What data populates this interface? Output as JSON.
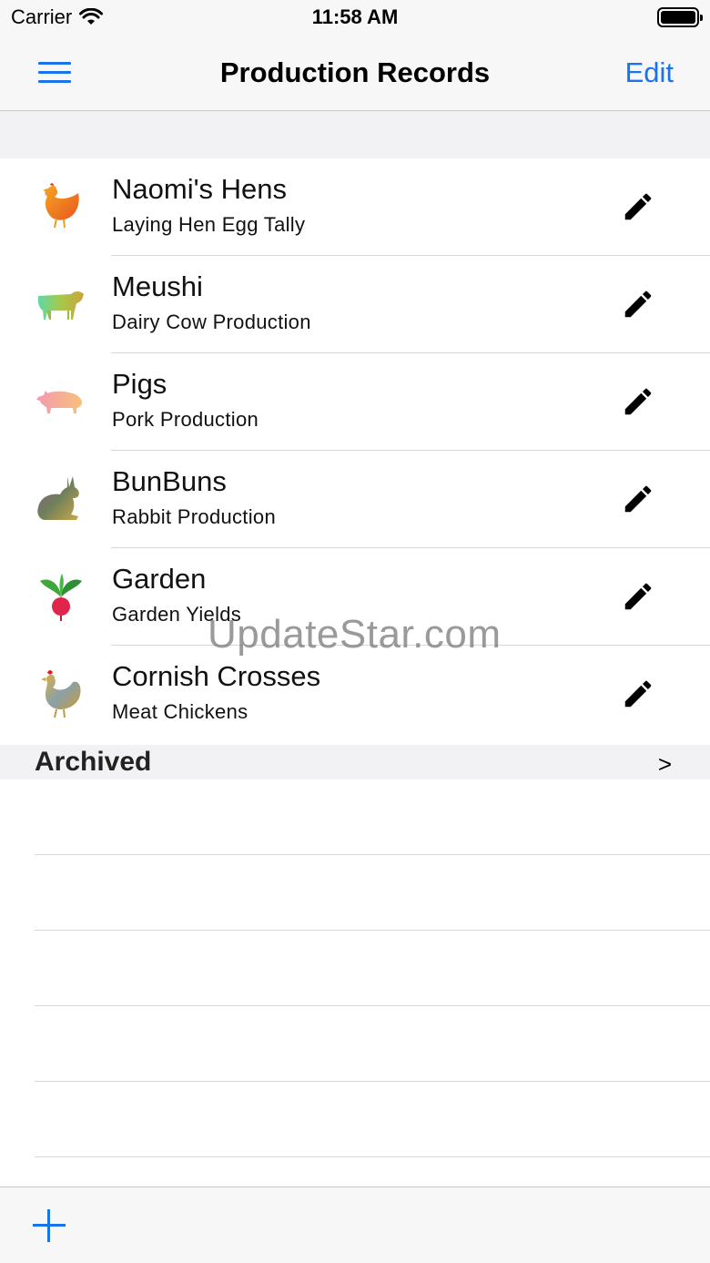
{
  "status_bar": {
    "carrier": "Carrier",
    "time": "11:58 AM"
  },
  "nav": {
    "title": "Production Records",
    "edit_label": "Edit",
    "accent_color": "#1a73e8"
  },
  "records": [
    {
      "name": "Naomi's Hens",
      "subtitle": "Laying Hen Egg Tally",
      "icon": "hen-icon"
    },
    {
      "name": "Meushi",
      "subtitle": "Dairy Cow Production",
      "icon": "cow-icon"
    },
    {
      "name": "Pigs",
      "subtitle": "Pork Production",
      "icon": "pig-icon"
    },
    {
      "name": "BunBuns",
      "subtitle": "Rabbit Production",
      "icon": "rabbit-icon"
    },
    {
      "name": "Garden",
      "subtitle": "Garden Yields",
      "icon": "radish-icon"
    },
    {
      "name": "Cornish Crosses",
      "subtitle": "Meat Chickens",
      "icon": "rooster-icon"
    }
  ],
  "archived": {
    "label": "Archived",
    "chevron": ">"
  },
  "watermark": "UpdateStar.com",
  "toolbar": {
    "add_icon": "plus-icon"
  }
}
